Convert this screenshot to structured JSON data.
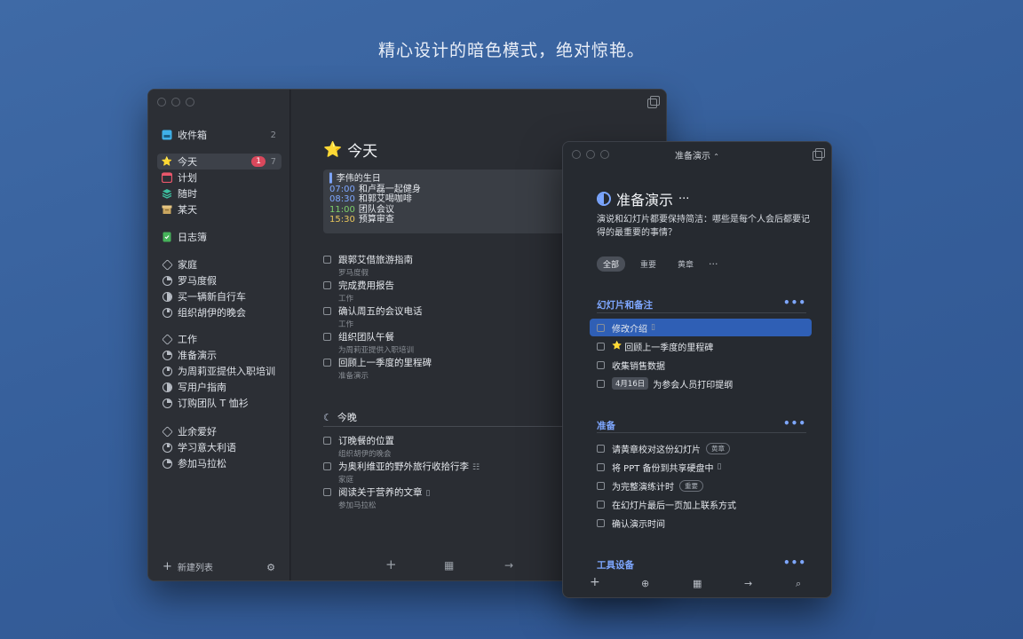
{
  "headline": "精心设计的暗色模式，绝对惊艳。",
  "sidebar": {
    "inbox": {
      "label": "收件箱",
      "count": "2"
    },
    "today": {
      "label": "今天",
      "badge": "1",
      "count": "7"
    },
    "upcoming": {
      "label": "计划"
    },
    "anytime": {
      "label": "随时"
    },
    "someday": {
      "label": "某天"
    },
    "logbook": {
      "label": "日志簿"
    },
    "areas": [
      {
        "label": "家庭",
        "projects": [
          "罗马度假",
          "买一辆新自行车",
          "组织胡伊的晚会"
        ]
      },
      {
        "label": "工作",
        "projects": [
          "准备演示",
          "为周莉亚提供入职培训",
          "写用户指南",
          "订购团队 T 恤衫"
        ]
      },
      {
        "label": "业余爱好",
        "projects": [
          "学习意大利语",
          "参加马拉松"
        ]
      }
    ],
    "new_list": "新建列表"
  },
  "today_view": {
    "title": "今天",
    "calendar": [
      {
        "time": "",
        "text": "李伟的生日"
      },
      {
        "time": "07:00",
        "text": "和卢磊一起健身"
      },
      {
        "time": "08:30",
        "text": "和郭艾喝咖啡"
      },
      {
        "time": "11:00",
        "text": "团队会议"
      },
      {
        "time": "15:30",
        "text": "预算审查"
      }
    ],
    "tasks": [
      {
        "title": "跟郭艾借旅游指南",
        "sub": "罗马度假"
      },
      {
        "title": "完成费用报告",
        "sub": "工作"
      },
      {
        "title": "确认周五的会议电话",
        "sub": "工作"
      },
      {
        "title": "组织团队午餐",
        "sub": "为周莉亚提供入职培训"
      },
      {
        "title": "回顾上一季度的里程碑",
        "sub": "准备演示"
      }
    ],
    "evening_title": "今晚",
    "evening_tasks": [
      {
        "title": "订晚餐的位置",
        "sub": "组织胡伊的晚会"
      },
      {
        "title": "为奥利维亚的野外旅行收拾行李",
        "sub": "家庭"
      },
      {
        "title": "阅读关于营养的文章",
        "sub": "参加马拉松"
      }
    ]
  },
  "detail": {
    "window_title": "准备演示",
    "title": "准备演示",
    "notes": "演说和幻灯片都要保持简洁：哪些是每个人会后都要记得的最重要的事情？",
    "filters": [
      "全部",
      "重要",
      "黄章"
    ],
    "headings": [
      {
        "label": "幻灯片和备注",
        "tasks": [
          {
            "title": "修改介绍"
          },
          {
            "title": "回顾上一季度的里程碑"
          },
          {
            "title": "收集销售数据"
          },
          {
            "title": "为参会人员打印提纲",
            "date": "4月16日"
          }
        ]
      },
      {
        "label": "准备",
        "tasks": [
          {
            "title": "请黄章校对这份幻灯片",
            "tag": "黄章"
          },
          {
            "title": "将 PPT 备份到共享硬盘中"
          },
          {
            "title": "为完整演练计时",
            "tag": "重要"
          },
          {
            "title": "在幻灯片最后一页加上联系方式"
          },
          {
            "title": "确认演示时间"
          }
        ]
      },
      {
        "label": "工具设备",
        "tasks": []
      }
    ]
  },
  "colors": {
    "accent": "#7ea7ff",
    "selection": "#2f5fb5",
    "badge": "#d9485c"
  }
}
